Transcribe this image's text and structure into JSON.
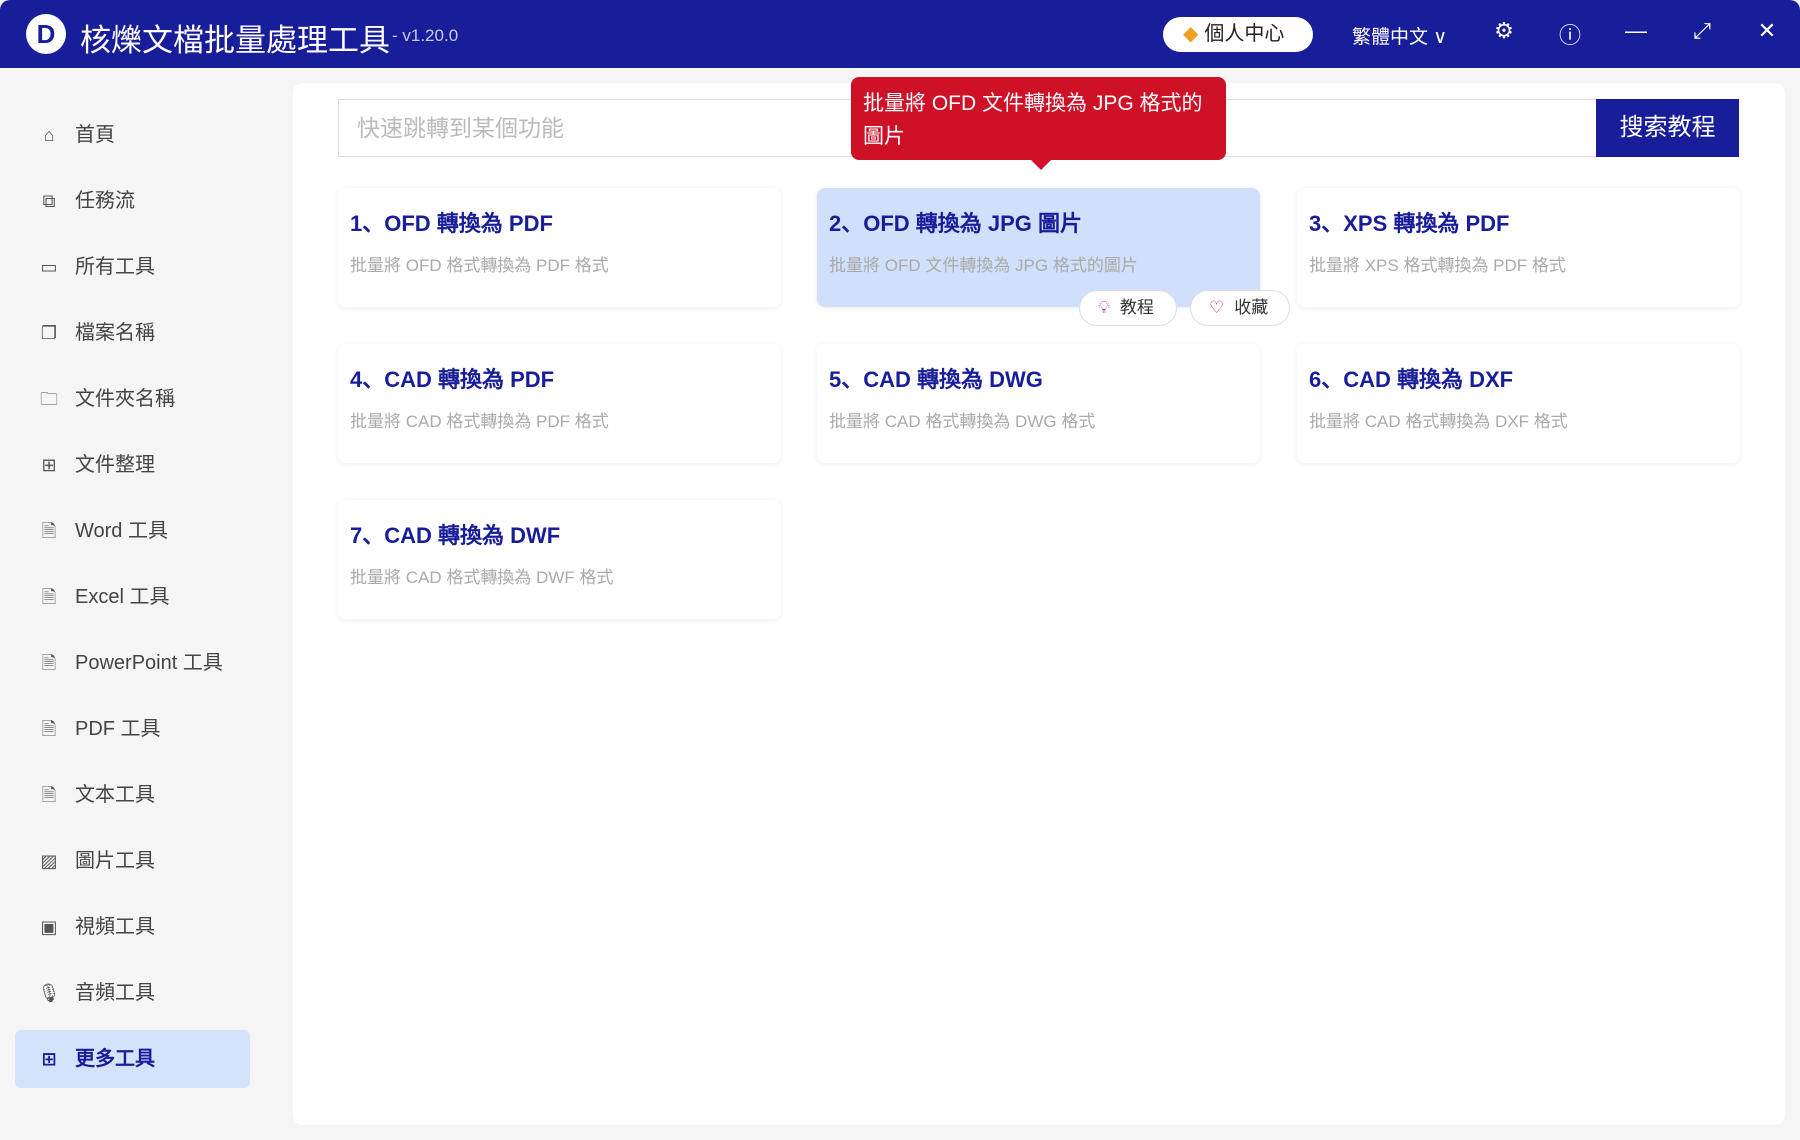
{
  "titlebar": {
    "logo": "D",
    "title": "核爍文檔批量處理工具",
    "version": "- v1.20.0",
    "user_center": "個人中心",
    "language": "繁體中文"
  },
  "sidebar": {
    "items": [
      {
        "label": "首頁",
        "icon": "home-icon"
      },
      {
        "label": "任務流",
        "icon": "workflow-icon"
      },
      {
        "label": "所有工具",
        "icon": "monitor-icon"
      },
      {
        "label": "檔案名稱",
        "icon": "file-copy-icon"
      },
      {
        "label": "文件夾名稱",
        "icon": "folder-icon"
      },
      {
        "label": "文件整理",
        "icon": "organize-icon"
      },
      {
        "label": "Word 工具",
        "icon": "word-icon"
      },
      {
        "label": "Excel 工具",
        "icon": "excel-icon"
      },
      {
        "label": "PowerPoint 工具",
        "icon": "powerpoint-icon"
      },
      {
        "label": "PDF 工具",
        "icon": "pdf-icon"
      },
      {
        "label": "文本工具",
        "icon": "text-icon"
      },
      {
        "label": "圖片工具",
        "icon": "image-icon"
      },
      {
        "label": "視頻工具",
        "icon": "video-icon"
      },
      {
        "label": "音頻工具",
        "icon": "audio-icon"
      },
      {
        "label": "更多工具",
        "icon": "grid-icon",
        "active": true
      }
    ]
  },
  "search": {
    "placeholder": "快速跳轉到某個功能",
    "button": "搜索教程"
  },
  "tooltip": "批量將 OFD 文件轉換為 JPG 格式的圖片",
  "cards": [
    {
      "title": "1、OFD 轉換為 PDF",
      "desc": "批量將 OFD 格式轉換為 PDF 格式"
    },
    {
      "title": "2、OFD 轉換為 JPG 圖片",
      "desc": "批量將 OFD 文件轉換為 JPG 格式的圖片"
    },
    {
      "title": "3、XPS 轉換為 PDF",
      "desc": "批量將 XPS 格式轉換為 PDF 格式"
    },
    {
      "title": "4、CAD 轉換為 PDF",
      "desc": "批量將 CAD 格式轉換為 PDF 格式"
    },
    {
      "title": "5、CAD 轉換為 DWG",
      "desc": "批量將 CAD 格式轉換為 DWG 格式"
    },
    {
      "title": "6、CAD 轉換為 DXF",
      "desc": "批量將 CAD 格式轉換為 DXF 格式"
    },
    {
      "title": "7、CAD 轉換為 DWF",
      "desc": "批量將 CAD 格式轉換為 DWF 格式"
    }
  ],
  "card_actions": {
    "tutorial": "教程",
    "favorite": "收藏"
  }
}
